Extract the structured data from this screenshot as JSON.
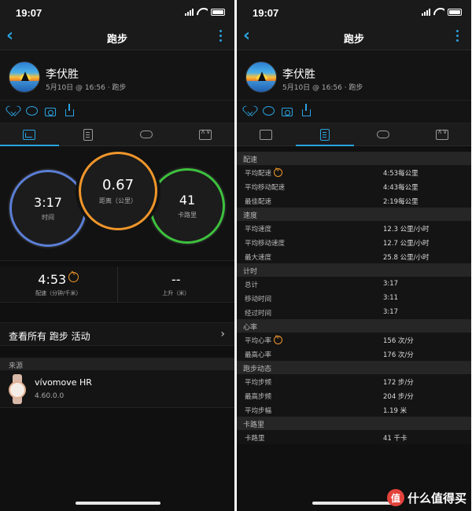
{
  "status": {
    "time": "19:07"
  },
  "nav": {
    "title": "跑步"
  },
  "profile": {
    "name": "李伏胜",
    "meta": "5月10日 @ 16:56 · 跑步"
  },
  "summary": {
    "time_value": "3:17",
    "time_label": "时间",
    "distance_value": "0.67",
    "distance_label": "距离（公里）",
    "calories_value": "41",
    "calories_label": "卡路里",
    "pace_value": "4:53",
    "pace_label": "配速（分钟/千米）",
    "ascent_value": "--",
    "ascent_label": "上升（米）",
    "colors": {
      "time": "#5b7fd6",
      "distance": "#f0962a",
      "calories": "#3dc23d"
    }
  },
  "view_all": {
    "label": "查看所有 跑步 活动",
    "chevron": "›"
  },
  "source": {
    "header": "来源",
    "device_name": "vívomove HR",
    "device_version": "4.60.0.0"
  },
  "details": [
    {
      "section": "配速",
      "rows": [
        {
          "key": "平均配速",
          "value": "4:53每公里",
          "icon": "pulse"
        },
        {
          "key": "平均移动配速",
          "value": "4:43每公里"
        },
        {
          "key": "最佳配速",
          "value": "2:19每公里"
        }
      ]
    },
    {
      "section": "速度",
      "rows": [
        {
          "key": "平均速度",
          "value": "12.3 公里/小时"
        },
        {
          "key": "平均移动速度",
          "value": "12.7 公里/小时"
        },
        {
          "key": "最大速度",
          "value": "25.8 公里/小时"
        }
      ]
    },
    {
      "section": "计时",
      "rows": [
        {
          "key": "总计",
          "value": "3:17"
        },
        {
          "key": "移动时间",
          "value": "3:11"
        },
        {
          "key": "经过时间",
          "value": "3:17"
        }
      ]
    },
    {
      "section": "心率",
      "rows": [
        {
          "key": "平均心率",
          "value": "156 次/分",
          "icon": "pulse"
        },
        {
          "key": "最高心率",
          "value": "176 次/分"
        }
      ]
    },
    {
      "section": "跑步动态",
      "rows": [
        {
          "key": "平均步频",
          "value": "172 步/分"
        },
        {
          "key": "最高步频",
          "value": "204 步/分"
        },
        {
          "key": "平均步幅",
          "value": "1.19 米"
        }
      ]
    },
    {
      "section": "卡路里",
      "rows": [
        {
          "key": "卡路里",
          "value": "41 千卡"
        }
      ]
    }
  ],
  "watermark": {
    "logo": "值",
    "text": "什么值得买"
  },
  "accent": "#2aa3e0"
}
